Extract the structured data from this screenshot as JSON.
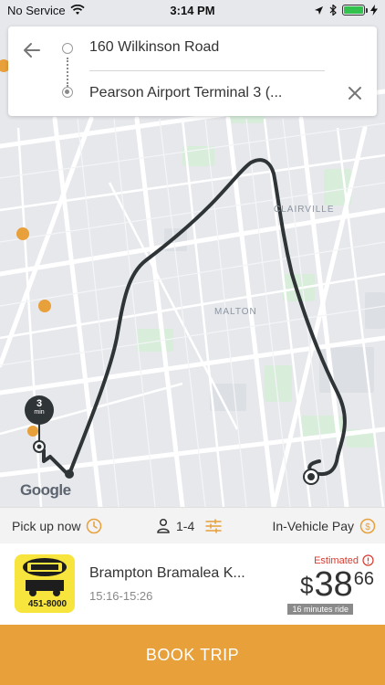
{
  "status_bar": {
    "carrier": "No Service",
    "time": "3:14 PM"
  },
  "route": {
    "origin": "160 Wilkinson Road",
    "destination": "Pearson Airport Terminal 3 (..."
  },
  "map": {
    "labels": [
      "CLAIRVILLE",
      "MALTON"
    ],
    "attribution": "Google",
    "eta": {
      "value": "3",
      "unit": "min"
    },
    "route_color": "#2f3437",
    "marker_color": "#e8a03b"
  },
  "options": {
    "pickup": "Pick up now",
    "passengers": "1-4",
    "payment": "In-Vehicle Pay",
    "accent": "#e8a03b"
  },
  "vehicle": {
    "name": "Brampton Bramalea K...",
    "time_window": "15:16-15:26",
    "logo_text": "451-8000",
    "estimated_label": "Estimated",
    "price_currency": "$",
    "price_int": "38",
    "price_cents": "66",
    "ride_time": "16 minutes ride"
  },
  "book_button": {
    "label": "BOOK TRIP",
    "color": "#e8a03b"
  }
}
